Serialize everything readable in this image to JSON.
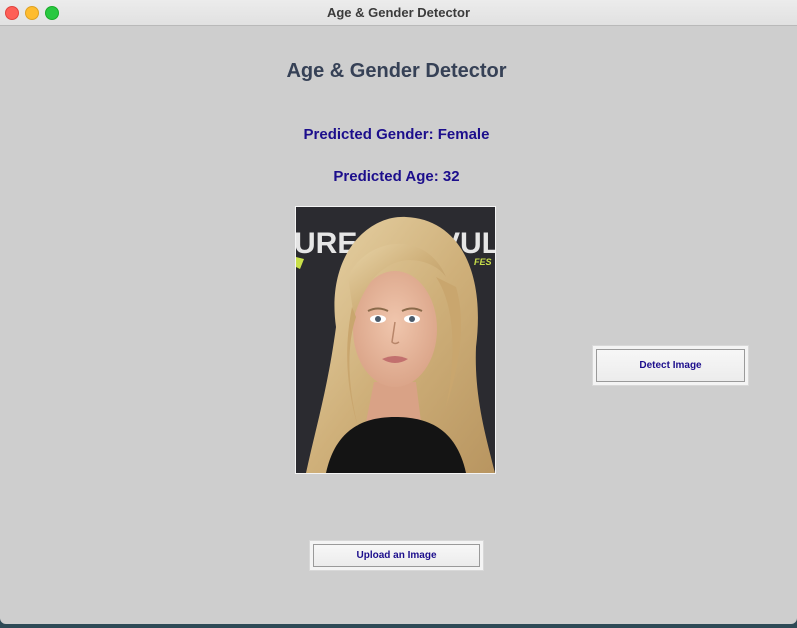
{
  "window": {
    "title": "Age & Gender Detector"
  },
  "main": {
    "heading": "Age & Gender Detector",
    "gender_text": "Predicted Gender: Female",
    "age_text": "Predicted Age: 32"
  },
  "photo": {
    "backdrop_text_left": "URE",
    "backdrop_text_right": "VULT",
    "backdrop_text_small": "FES"
  },
  "buttons": {
    "detect_label": "Detect Image",
    "upload_label": "Upload an Image"
  },
  "colors": {
    "window_bg": "#cecece",
    "heading": "#364156",
    "prediction_text": "#1c0e8c"
  }
}
